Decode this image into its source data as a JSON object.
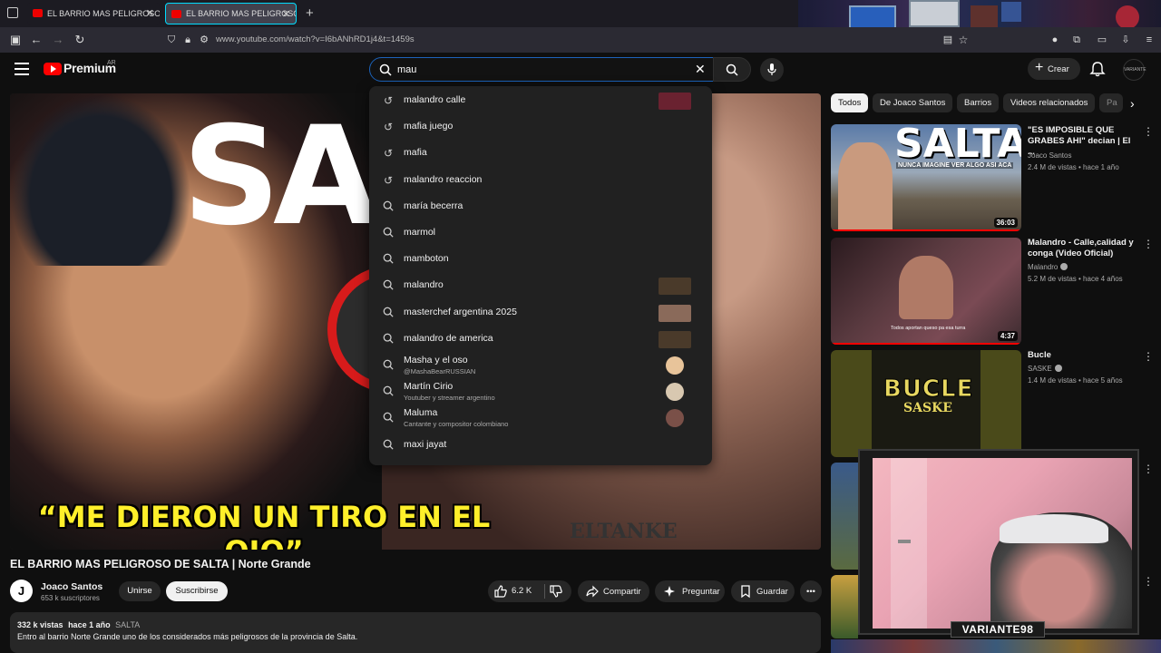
{
  "browser": {
    "tabs": [
      {
        "label": "EL BARRIO MAS PELIGROSO DE"
      },
      {
        "label": "EL BARRIO MAS PELIGROSO DE"
      }
    ],
    "url": "www.youtube.com/watch?v=I6bANhRD1j4&t=1459s",
    "new_tab": "+"
  },
  "header": {
    "brand": "Premium",
    "country": "AR",
    "search_value": "mau",
    "create_label": "Crear",
    "avatar_text": "VARIANTE"
  },
  "suggestions": [
    {
      "text": "malandro calle",
      "kind": "history",
      "thumb": "#6a2230"
    },
    {
      "text": "mafia juego",
      "kind": "history"
    },
    {
      "text": "mafia",
      "kind": "history"
    },
    {
      "text": "malandro reaccion",
      "kind": "history"
    },
    {
      "text": "maría becerra",
      "kind": "search"
    },
    {
      "text": "marmol",
      "kind": "search"
    },
    {
      "text": "mamboton",
      "kind": "search"
    },
    {
      "text": "malandro",
      "kind": "search",
      "thumb": "#4a3a2a"
    },
    {
      "text": "masterchef argentina 2025",
      "kind": "search",
      "thumb": "#8a6a5a"
    },
    {
      "text": "malandro de america",
      "kind": "search",
      "thumb": "#4a3a2a"
    },
    {
      "text": "Masha y el oso",
      "sub": "@MashaBearRUSSIAN",
      "kind": "channel",
      "thumb": "#e8c49a"
    },
    {
      "text": "Martín Cirio",
      "sub": "Youtuber y streamer argentino",
      "kind": "channel",
      "thumb": "#d8c8b0"
    },
    {
      "text": "Maluma",
      "sub": "Cantante y compositor colombiano",
      "kind": "channel",
      "thumb": "#7a5048"
    },
    {
      "text": "maxi jayat",
      "kind": "search"
    }
  ],
  "video": {
    "big_text": "SA",
    "subtitle": "“ME DIERON UN TIRO EN EL OJO”",
    "tattoo": "ELTANKE",
    "title": "EL BARRIO MAS PELIGROSO DE SALTA | Norte Grande"
  },
  "channel": {
    "initial": "J",
    "name": "Joaco Santos",
    "subs": "653 k suscriptores",
    "join": "Unirse",
    "subscribe": "Suscribirse"
  },
  "actions": {
    "likes": "6.2 K",
    "share": "Compartir",
    "ask": "Preguntar",
    "save": "Guardar"
  },
  "description": {
    "views": "332 k vistas",
    "age": "hace 1 año",
    "tag": "SALTA",
    "text": "Entro al barrio Norte Grande uno de los considerados más peligrosos de la provincia de Salta."
  },
  "chips": [
    "Todos",
    "De Joaco Santos",
    "Barrios",
    "Videos relacionados",
    "Pa"
  ],
  "recommended": [
    {
      "title": "\"ES IMPOSIBLE QUE GRABES AHI\" decian | El ...",
      "channel": "Joaco Santos",
      "meta": "2.4 M de vistas • hace 1 año",
      "duration": "36:03",
      "thumb_text": "SALTA",
      "thumb_sub": "NUNCA IMAGINE VER ALGO ASI ACA",
      "verified": false
    },
    {
      "title": "Malandro - Calle,calidad y conga (Video Oficial)",
      "channel": "Malandro",
      "meta": "5.2 M de vistas • hace 4 años",
      "duration": "4:37",
      "thumb_caption": "Todos aportan queso pa esa turra",
      "verified": true
    },
    {
      "title": "Bucle",
      "channel": "SASKE",
      "meta": "1.4 M de vistas • hace 5 años",
      "thumb_text": "BUCLE",
      "thumb_sub": "SASKE",
      "verified": true
    }
  ],
  "webcam": {
    "name": "VARIANTE98"
  },
  "colors": {
    "accent_red": "#ff0000",
    "search_border": "#1c62b9",
    "subtitle_yellow": "#ffef2a"
  }
}
